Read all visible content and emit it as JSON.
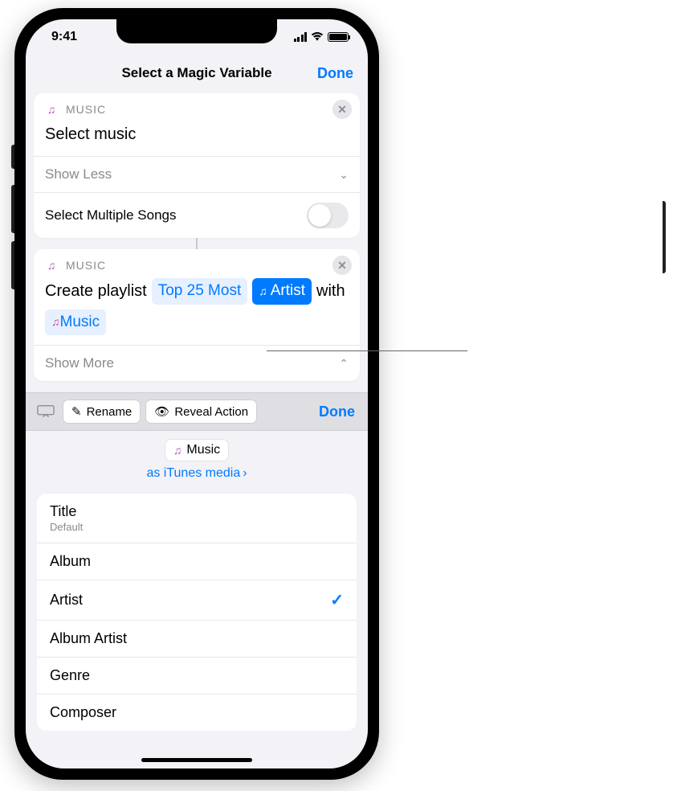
{
  "status": {
    "time": "9:41"
  },
  "nav": {
    "title": "Select a Magic Variable",
    "done": "Done"
  },
  "card1": {
    "app": "MUSIC",
    "title": "Select music",
    "show_less": "Show Less",
    "multi_label": "Select Multiple Songs"
  },
  "card2": {
    "app": "MUSIC",
    "prefix": "Create playlist",
    "token_name": "Top 25 Most",
    "token_property": "Artist",
    "middle": "with",
    "token_var": "Music",
    "show_more": "Show More"
  },
  "toolbar": {
    "rename": "Rename",
    "reveal": "Reveal Action",
    "done": "Done"
  },
  "variable": {
    "name": "Music",
    "as_label": "as iTunes media"
  },
  "props": [
    {
      "label": "Title",
      "sub": "Default",
      "selected": false
    },
    {
      "label": "Album",
      "sub": "",
      "selected": false
    },
    {
      "label": "Artist",
      "sub": "",
      "selected": true
    },
    {
      "label": "Album Artist",
      "sub": "",
      "selected": false
    },
    {
      "label": "Genre",
      "sub": "",
      "selected": false
    },
    {
      "label": "Composer",
      "sub": "",
      "selected": false
    }
  ]
}
